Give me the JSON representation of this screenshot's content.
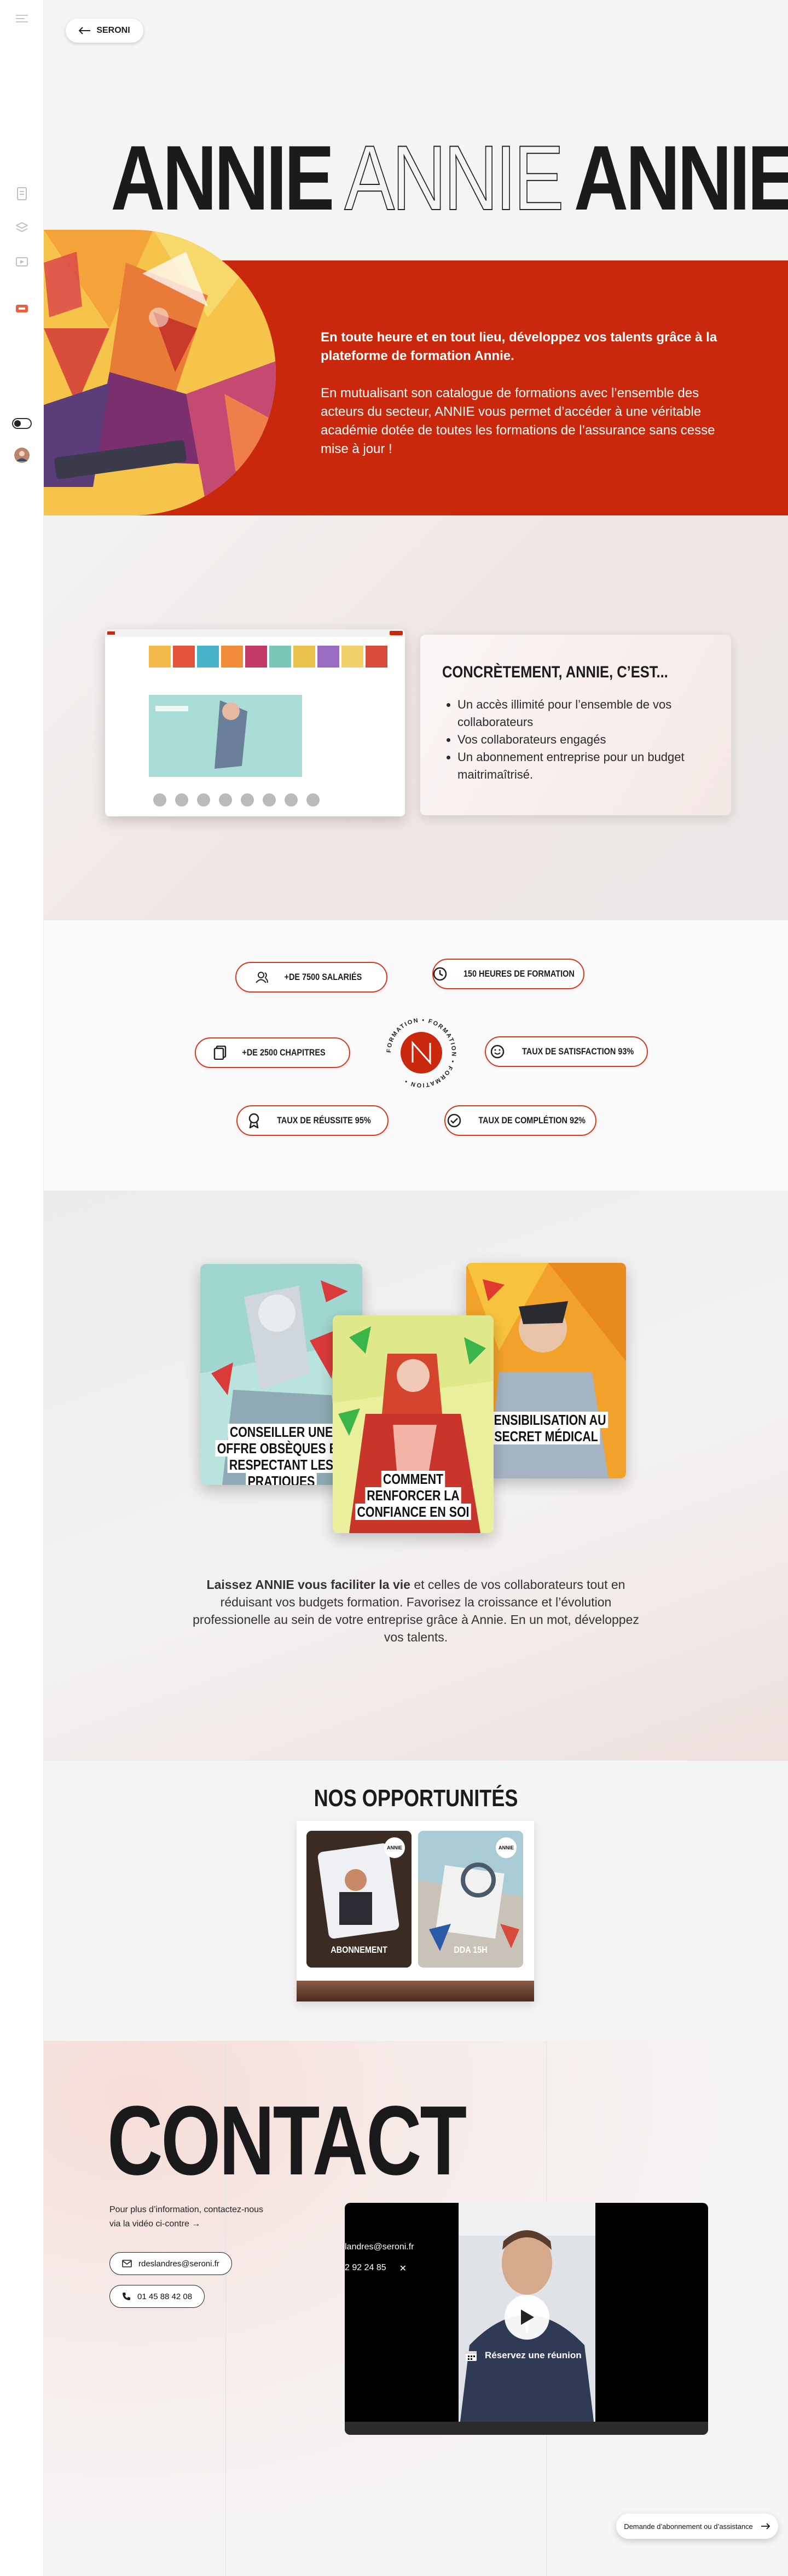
{
  "colors": {
    "accent": "#c9280c",
    "pill_border": "#d33b18",
    "sidebar_bg": "#ffffff",
    "page_bg": "#f5f4f4"
  },
  "nav": {
    "back_label": "SERONI"
  },
  "sidebar": {
    "icons": [
      "menu-icon",
      "document-icon",
      "layers-icon",
      "media-icon",
      "shop-icon",
      "toggle-icon",
      "avatar"
    ]
  },
  "hero": {
    "title_word": "ANNIE",
    "lead": "En toute heure et en tout lieu, développez vos talents grâce à la plateforme de formation Annie.",
    "body": "En mutualisant son catalogue de formations avec l’ensemble des acteurs du secteur, ANNIE vous permet d’accéder à une véritable académie dotée de toutes les formations de l’assurance sans cesse mise à jour !"
  },
  "concrete": {
    "title": "CONCRÈTEMENT, ANNIE, C’EST...",
    "items": [
      "Un accès illimité pour l’ensemble de vos collaborateurs",
      "Vos collaborateurs engagés",
      "Un abonnement entreprise pour un budget maitrimaîtrisé."
    ]
  },
  "stats": {
    "salaries": "+DE 7500 SALARIÉS",
    "heures": "150 HEURES DE FORMATION",
    "chapitres": "+DE 2500 CHAPITRES",
    "satisfaction": "TAUX DE SATISFACTION 93%",
    "reussite": "TAUX DE RÉUSSITE 95%",
    "completion": "TAUX DE COMPLÉTION 92%",
    "seal_text": "FORMATION • FORMATION • FORMATION •"
  },
  "books": [
    {
      "title": "CONSEILLER UNE OFFRE OBSÈQUES EN RESPECTANT LES PRATIQUES COMMERCIALES"
    },
    {
      "title": "COMMENT RENFORCER LA CONFIANCE EN SOI"
    },
    {
      "title": "SENSIBILISATION AU SECRET MÉDICAL"
    }
  ],
  "intro": {
    "bold": "Laissez ANNIE vous faciliter la vie",
    "rest": " et celles de vos collaborateurs tout en réduisant vos budgets formation. Favorisez la croissance et l’évolution professionelle au sein de votre entreprise grâce à Annie. En un mot, développez vos talents."
  },
  "opportunities": {
    "title": "NOS OPPORTUNITÉS",
    "items": [
      {
        "label": "ABONNEMENT",
        "badge": "ANNIE"
      },
      {
        "label": "DDA 15H",
        "badge": "ANNIE"
      }
    ]
  },
  "contact": {
    "title": "CONTACT",
    "text": "Pour plus d’information, contactez-nous via la vidéo ci-contre →",
    "email": "rdeslandres@seroni.fr",
    "phone": "01 45 88 42 08",
    "video_email_fragment": "landres@seroni.fr",
    "video_phone_fragment": "2 92 24 85",
    "meeting": "Réservez une réunion"
  },
  "help": {
    "label": "Demande d’abonnement ou d’assistance"
  }
}
